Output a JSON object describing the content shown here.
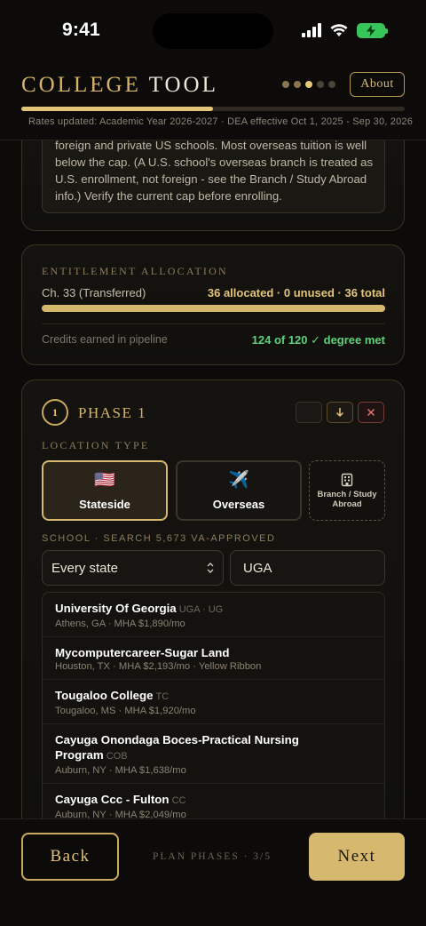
{
  "status_bar": {
    "time": "9:41"
  },
  "header": {
    "title_word1": "COLLEGE",
    "title_word2": "TOOL",
    "about_label": "About",
    "step_current": 3,
    "step_total": 5,
    "progress_fraction": 0.5,
    "rates_text": "Rates updated: Academic Year 2026-2027 · DEA effective Oct 1, 2025 - Sep 30, 2026"
  },
  "info_card": {
    "text": "foreign and private US schools. Most overseas tuition is well below the cap. (A U.S. school's overseas branch is treated as U.S. enrollment, not foreign - see the Branch / Study Abroad info.) Verify the current cap before enrolling."
  },
  "entitlement": {
    "label": "ENTITLEMENT ALLOCATION",
    "chapter": "Ch. 33 (Transferred)",
    "summary": "36 allocated · 0 unused · 36 total",
    "allocated_fraction": 1.0,
    "credits_label": "Credits earned in pipeline",
    "credits_value": "124 of 120 ✓ degree met"
  },
  "phase": {
    "number": "1",
    "title": "PHASE 1",
    "location_label": "LOCATION TYPE",
    "locations": [
      {
        "emoji": "🇺🇸",
        "label": "Stateside",
        "selected": true
      },
      {
        "emoji": "✈️",
        "label": "Overseas",
        "selected": false
      },
      {
        "label": "Branch / Study Abroad",
        "selected": false
      }
    ],
    "school_label": "SCHOOL · SEARCH 5,673 VA-APPROVED",
    "state_select": "Every state",
    "search_value": "UGA",
    "results": [
      {
        "name": "University Of Georgia",
        "tag": "UGA · UG",
        "meta": "Athens, GA · MHA $1,890/mo"
      },
      {
        "name": "Mycomputercareer-Sugar Land",
        "tag": "",
        "meta": "Houston, TX · MHA $2,193/mo · Yellow Ribbon"
      },
      {
        "name": "Tougaloo College",
        "tag": "TC",
        "meta": "Tougaloo, MS · MHA $1,920/mo"
      },
      {
        "name": "Cayuga Onondaga Boces-Practical Nursing Program",
        "tag": "COB",
        "meta": "Auburn, NY · MHA $1,638/mo"
      },
      {
        "name": "Cayuga Ccc - Fulton",
        "tag": "CC",
        "meta": "Auburn, NY · MHA $2,049/mo"
      }
    ]
  },
  "footer": {
    "back_label": "Back",
    "phases_text": "PLAN PHASES · 3/5",
    "next_label": "Next"
  },
  "colors": {
    "gold": "#d6b46a",
    "green": "#5fd07a",
    "red": "#ea6e66",
    "background": "#0c0b0a"
  }
}
